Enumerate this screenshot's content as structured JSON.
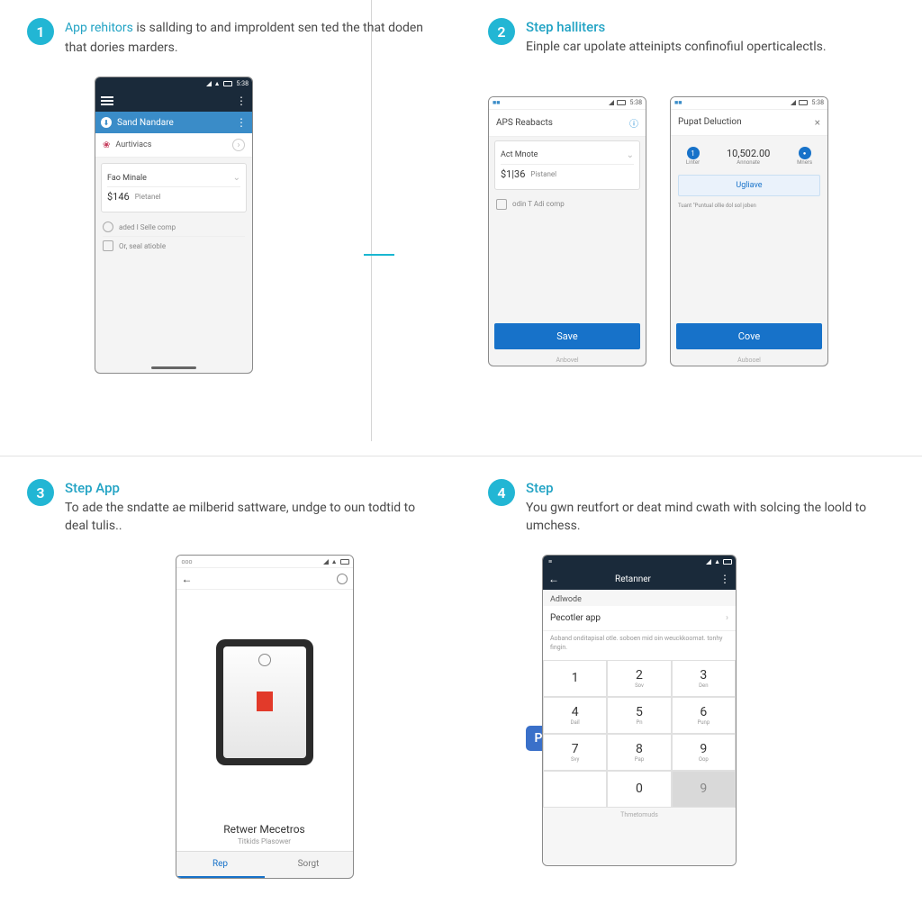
{
  "step1": {
    "num": "1",
    "lead": "App rehitors",
    "text": " is sallding to and improldent sen ted the that doden that dories marders.",
    "phone": {
      "appbar_title": "Sand Nandare",
      "row_activities": "Aurtiviacs",
      "field_label": "Fao Minale",
      "amount": "$146",
      "amount_sub": "Pietanel",
      "opt1": "aded I Selle comp",
      "opt2": "Or, seal atioble"
    }
  },
  "step2": {
    "num": "2",
    "title": "Step halliters",
    "desc": "Einple car upolate atteinipts confinofiul operticalectls.",
    "phoneA": {
      "header": "APS Reabacts",
      "field_label": "Act Mnote",
      "amount": "$1|36",
      "amount_sub": "Pistanel",
      "opt1": "odin T Adi comp",
      "button": "Save",
      "footer": "Anbovel"
    },
    "phoneB": {
      "header": "Pupat Deluction",
      "col1_badge": "1",
      "col1_sub": "Linter",
      "val": "10,502.00",
      "val_sub": "Annonate",
      "col3_badge": "●",
      "col3_sub": "Mners",
      "button_light": "Ugliave",
      "note": "Tuant \"Puntual ollie dol sol joben",
      "button": "Cove",
      "footer": "Aubooel"
    }
  },
  "step3": {
    "num": "3",
    "title": "Step App",
    "desc": "To ade the sndatte ae milberid sattware, undge to oun todtid to deal tulis..",
    "device_name": "Retwer Mecetros",
    "device_sub": "Titkids Plasower",
    "tab1": "Rep",
    "tab2": "Sorgt"
  },
  "step4": {
    "num": "4",
    "title": "Step",
    "desc": "You gwn reutfort or deat mind cwath with solcing the loold to umchess.",
    "appbar_title": "Retanner",
    "section": "Adlwode",
    "item": "Pecotler app",
    "item_sub": "Aoband onditapisal otle. soboen mid oin weuckkoomat. tonhy fingin.",
    "badge": "P",
    "keys": [
      {
        "n": "1",
        "s": ""
      },
      {
        "n": "2",
        "s": "Sov"
      },
      {
        "n": "3",
        "s": "Den"
      },
      {
        "n": "4",
        "s": "Dail"
      },
      {
        "n": "5",
        "s": "Pn"
      },
      {
        "n": "6",
        "s": "Punp"
      },
      {
        "n": "7",
        "s": "Svy"
      },
      {
        "n": "8",
        "s": "Pap"
      },
      {
        "n": "9",
        "s": "Oop"
      },
      {
        "n": "",
        "s": ""
      },
      {
        "n": "0",
        "s": ""
      },
      {
        "n": "9",
        "s": ""
      }
    ],
    "footer": "Thmetomuds"
  }
}
